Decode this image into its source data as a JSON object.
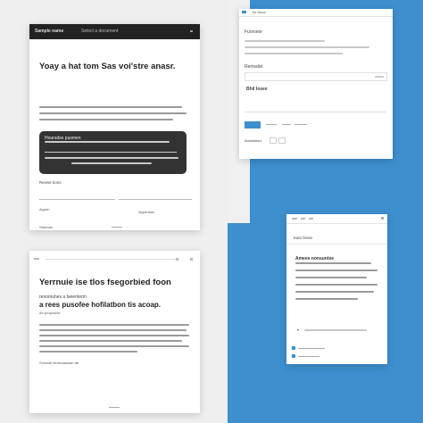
{
  "colors": {
    "accent": "#3d8fce",
    "dark_panel": "#333333",
    "background": "#efefef"
  },
  "card1": {
    "topbar_left": "Sample name",
    "topbar_right": "Select a document",
    "headline": "Yoay a hat tom Sas voi'stre anasr.",
    "dark_panel_heading": "Hoursdse pusmen",
    "small_label": "Revise tions",
    "field_label_1": "Appen",
    "field_label_2": "Appensee",
    "field_label_3": "Sthenan"
  },
  "card2": {
    "topbar_title": "Jte Itisas",
    "label_1": "Fuorsete",
    "label_2": "Remsdat",
    "label_3": "Bhil Iosee",
    "select_label": "Aonsdstsd"
  },
  "card3": {
    "headline": "Yerrnuie ise tlos fsegorbied foon",
    "subline_1": "renomuhes a beienterm",
    "headline_2": "a rees pusofee hofilatbon tis acoap.",
    "subline_2": "An proposine",
    "small_label": "Somaat mnesuasisan tre"
  },
  "card4": {
    "nav_label": "Kalo fesse",
    "heading": "Amees nonsuntse"
  }
}
